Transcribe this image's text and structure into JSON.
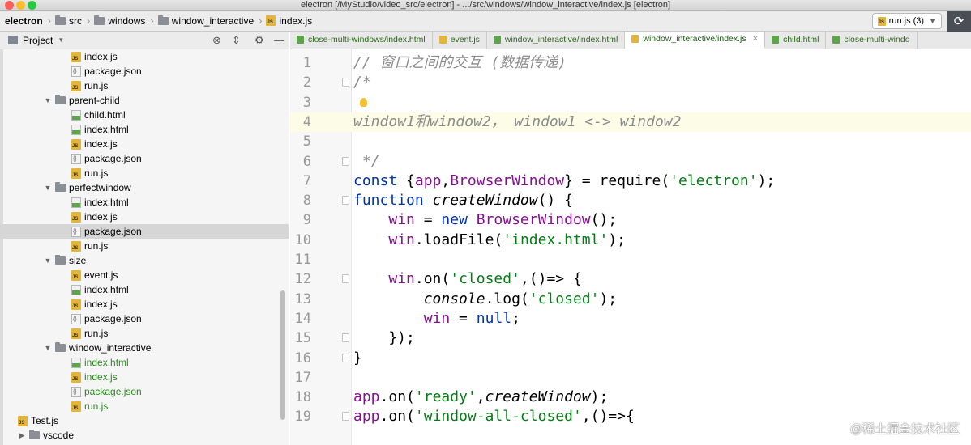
{
  "window": {
    "title": "electron [/MyStudio/video_src/electron] - .../src/windows/window_interactive/index.js [electron]"
  },
  "breadcrumb": [
    "electron",
    "src",
    "windows",
    "window_interactive",
    "index.js"
  ],
  "run_config": {
    "label": "run.js (3)"
  },
  "project_panel": {
    "title": "Project"
  },
  "tree": [
    {
      "label": "index.js",
      "type": "js",
      "indent": 2
    },
    {
      "label": "package.json",
      "type": "json",
      "indent": 2
    },
    {
      "label": "run.js",
      "type": "js",
      "indent": 2
    },
    {
      "label": "parent-child",
      "type": "folder",
      "indent": 1
    },
    {
      "label": "child.html",
      "type": "html",
      "indent": 2
    },
    {
      "label": "index.html",
      "type": "html",
      "indent": 2
    },
    {
      "label": "index.js",
      "type": "js",
      "indent": 2
    },
    {
      "label": "package.json",
      "type": "json",
      "indent": 2
    },
    {
      "label": "run.js",
      "type": "js",
      "indent": 2
    },
    {
      "label": "perfectwindow",
      "type": "folder",
      "indent": 1
    },
    {
      "label": "index.html",
      "type": "html",
      "indent": 2
    },
    {
      "label": "index.js",
      "type": "js",
      "indent": 2
    },
    {
      "label": "package.json",
      "type": "json",
      "indent": 2,
      "selected": true
    },
    {
      "label": "run.js",
      "type": "js",
      "indent": 2
    },
    {
      "label": "size",
      "type": "folder",
      "indent": 1
    },
    {
      "label": "event.js",
      "type": "js",
      "indent": 2
    },
    {
      "label": "index.html",
      "type": "html",
      "indent": 2
    },
    {
      "label": "index.js",
      "type": "js",
      "indent": 2
    },
    {
      "label": "package.json",
      "type": "json",
      "indent": 2
    },
    {
      "label": "run.js",
      "type": "js",
      "indent": 2
    },
    {
      "label": "window_interactive",
      "type": "folder",
      "indent": 1
    },
    {
      "label": "index.html",
      "type": "html",
      "indent": 2,
      "green": true
    },
    {
      "label": "index.js",
      "type": "js",
      "indent": 2,
      "green": true
    },
    {
      "label": "package.json",
      "type": "json",
      "indent": 2,
      "green": true
    },
    {
      "label": "run.js",
      "type": "js",
      "indent": 2,
      "green": true
    },
    {
      "label": "Test.js",
      "type": "js",
      "indent": 0
    },
    {
      "label": "vscode",
      "type": "folder-collapsed",
      "indent": 0
    }
  ],
  "tabs": [
    {
      "label": "close-multi-windows/index.html",
      "type": "html"
    },
    {
      "label": "event.js",
      "type": "js"
    },
    {
      "label": "window_interactive/index.html",
      "type": "html"
    },
    {
      "label": "window_interactive/index.js",
      "type": "js",
      "active": true
    },
    {
      "label": "child.html",
      "type": "html"
    },
    {
      "label": "close-multi-windo",
      "type": "html"
    }
  ],
  "code_lines": [
    {
      "n": "1",
      "t": "// 窗口之间的交互 (数据传递)"
    },
    {
      "n": "2",
      "t": "/*"
    },
    {
      "n": "3",
      "t": ""
    },
    {
      "n": "4",
      "t": "window1和window2， window1 <-> window2"
    },
    {
      "n": "5",
      "t": ""
    },
    {
      "n": "6",
      "t": " */"
    },
    {
      "n": "7",
      "t": "const {app,BrowserWindow} = require('electron');"
    },
    {
      "n": "8",
      "t": "function createWindow() {"
    },
    {
      "n": "9",
      "t": "    win = new BrowserWindow();"
    },
    {
      "n": "10",
      "t": "    win.loadFile('index.html');"
    },
    {
      "n": "11",
      "t": ""
    },
    {
      "n": "12",
      "t": "    win.on('closed',()=> {"
    },
    {
      "n": "13",
      "t": "        console.log('closed');"
    },
    {
      "n": "14",
      "t": "        win = null;"
    },
    {
      "n": "15",
      "t": "    });"
    },
    {
      "n": "16",
      "t": "}"
    },
    {
      "n": "17",
      "t": ""
    },
    {
      "n": "18",
      "t": "app.on('ready',createWindow);"
    },
    {
      "n": "19",
      "t": "app.on('window-all-closed',()=>{"
    }
  ],
  "watermark": "@稀土掘金技术社区",
  "colors": {
    "accent_green": "#2b8a1e",
    "keyword": "#0033b3",
    "string": "#067d17",
    "comment": "#8c8c8c",
    "var": "#871094"
  }
}
